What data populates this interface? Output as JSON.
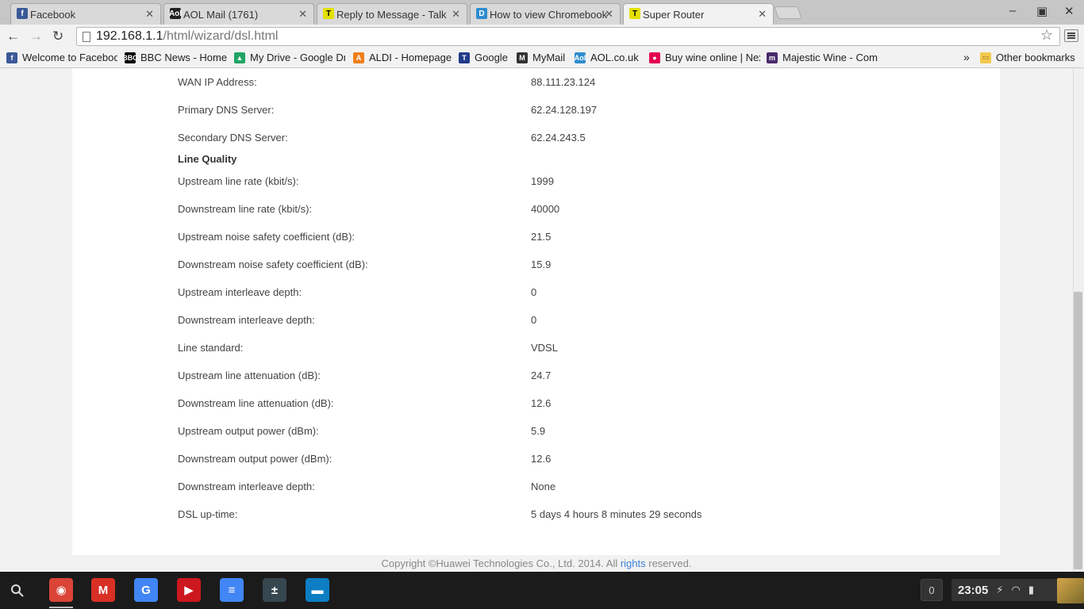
{
  "tabs": [
    {
      "title": "Facebook",
      "icon": "facebook-icon",
      "color": "#3b5998",
      "glyph": "f"
    },
    {
      "title": "AOL Mail (1761)",
      "icon": "aol-icon",
      "color": "#222222",
      "glyph": "Aol"
    },
    {
      "title": "Reply to Message - Talk",
      "icon": "talktalk-icon",
      "color": "#e2e000",
      "glyph": "T"
    },
    {
      "title": "How to view Chromebook",
      "icon": "dell-icon",
      "color": "#2f8ccf",
      "glyph": "D"
    },
    {
      "title": "Super Router",
      "icon": "talktalk-icon",
      "color": "#e2e000",
      "glyph": "T"
    }
  ],
  "window_controls": {
    "minimize": "–",
    "maximize": "▣",
    "close": "✕"
  },
  "toolbar": {
    "back": "←",
    "forward": "→",
    "reload": "↻",
    "url_host": "192.168.1.1",
    "url_path": "/html/wizard/dsl.html",
    "star": "☆"
  },
  "bookmarks": [
    {
      "label": "Welcome to Faceboo",
      "icon": "facebook-icon",
      "color": "#3b5998",
      "glyph": "f"
    },
    {
      "label": "BBC News - Home",
      "icon": "bbc-icon",
      "color": "#000000",
      "glyph": "BBC"
    },
    {
      "label": "My Drive - Google Dri",
      "icon": "google-drive-icon",
      "color": "#1fa463",
      "glyph": "▲"
    },
    {
      "label": "ALDI - Homepage",
      "icon": "aldi-icon",
      "color": "#f07f1b",
      "glyph": "A"
    },
    {
      "label": "Google",
      "icon": "google-icon",
      "color": "#1f3a8a",
      "glyph": "T"
    },
    {
      "label": "MyMail",
      "icon": "mymail-icon",
      "color": "#333333",
      "glyph": "M"
    },
    {
      "label": "AOL.co.uk",
      "icon": "aol-icon",
      "color": "#2f8ccf",
      "glyph": "Aol"
    },
    {
      "label": "Buy wine online | Nex",
      "icon": "wine-pin-icon",
      "color": "#e4004f",
      "glyph": "●"
    },
    {
      "label": "Majestic Wine - Com",
      "icon": "majestic-icon",
      "color": "#4a2a6a",
      "glyph": "m"
    }
  ],
  "bookmarks_overflow": "»",
  "other_bookmarks": "Other bookmarks",
  "dsl": {
    "wan_rows": [
      {
        "label": "WAN IP Address:",
        "value": "88.111.23.124"
      },
      {
        "label": "Primary DNS Server:",
        "value": "62.24.128.197"
      },
      {
        "label": "Secondary DNS Server:",
        "value": "62.24.243.5"
      }
    ],
    "line_quality_heading": "Line Quality",
    "quality_rows": [
      {
        "label": "Upstream line rate (kbit/s):",
        "value": "1999"
      },
      {
        "label": "Downstream line rate (kbit/s):",
        "value": "40000"
      },
      {
        "label": "Upstream noise safety coefficient (dB):",
        "value": "21.5"
      },
      {
        "label": "Downstream noise safety coefficient (dB):",
        "value": "15.9"
      },
      {
        "label": "Upstream interleave depth:",
        "value": "0"
      },
      {
        "label": "Downstream interleave depth:",
        "value": "0"
      },
      {
        "label": "Line standard:",
        "value": "VDSL"
      },
      {
        "label": "Upstream line attenuation (dB):",
        "value": "24.7"
      },
      {
        "label": "Downstream line attenuation (dB):",
        "value": "12.6"
      },
      {
        "label": "Upstream output power (dBm):",
        "value": "5.9"
      },
      {
        "label": "Downstream output power (dBm):",
        "value": "12.6"
      },
      {
        "label": "Downstream interleave depth:",
        "value": "None"
      },
      {
        "label": "DSL up-time:",
        "value": "5 days 4 hours 8 minutes 29 seconds"
      }
    ]
  },
  "footer": {
    "prefix": "Copyright ©Huawei Technologies Co., Ltd. 2014. All ",
    "link": "rights",
    "suffix": " reserved."
  },
  "shelf": {
    "apps": [
      {
        "name": "chrome-icon",
        "color": "#db4437",
        "glyph": "◉"
      },
      {
        "name": "gmail-icon",
        "color": "#d93025",
        "glyph": "M"
      },
      {
        "name": "google-search-icon",
        "color": "#4285f4",
        "glyph": "G"
      },
      {
        "name": "youtube-icon",
        "color": "#cc181e",
        "glyph": "▶"
      },
      {
        "name": "docs-icon",
        "color": "#4285f4",
        "glyph": "≡"
      },
      {
        "name": "calculator-icon",
        "color": "#37474f",
        "glyph": "±"
      },
      {
        "name": "files-icon",
        "color": "#0d7ec4",
        "glyph": "▬"
      }
    ],
    "notification_count": "0",
    "time": "23:05"
  }
}
